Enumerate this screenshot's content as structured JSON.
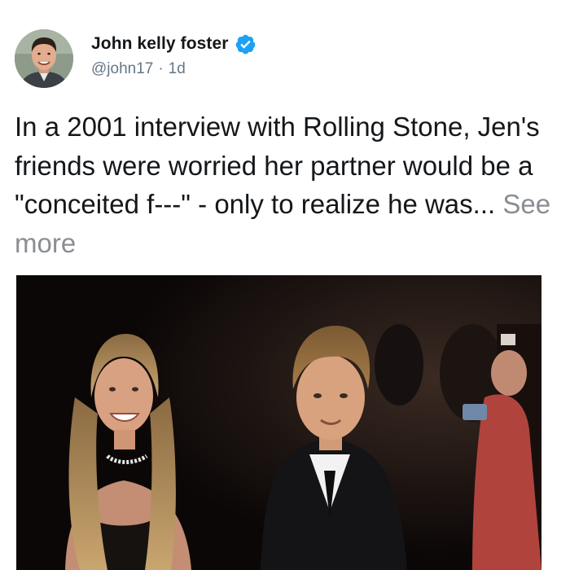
{
  "author": {
    "display_name": "John kelly foster",
    "handle": "@john17",
    "separator": "·",
    "timestamp": "1d",
    "verified": true,
    "avatar_icon": "profile-photo"
  },
  "tweet": {
    "text": "In a 2001 interview with Rolling Stone, Jen's friends were worried her partner would be a \"conceited f---\" - only to realize he was... ",
    "see_more_label": "See more"
  },
  "colors": {
    "text": "#14171a",
    "secondary": "#657786",
    "see_more": "#8a8d91",
    "verified_blue": "#1da1f2",
    "media_background": "#0b0707"
  },
  "media": {
    "type": "photo"
  }
}
